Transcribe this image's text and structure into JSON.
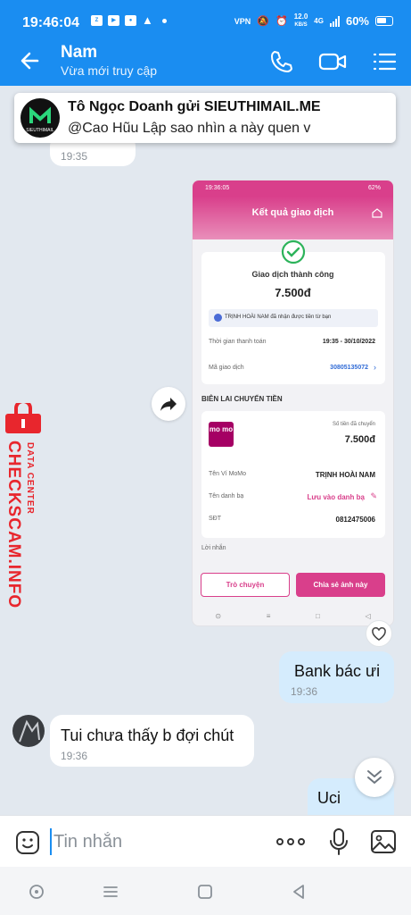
{
  "status_bar": {
    "time": "19:46:04",
    "speed_value": "12.0",
    "speed_unit": "KB/S",
    "battery": "60%",
    "left_icons": [
      "zalo-icon",
      "youtube-icon",
      "messenger-icon",
      "warning-icon",
      "dot-icon"
    ],
    "right_icons": [
      "vpn-icon",
      "mute-icon",
      "alarm-icon",
      "speed-icon",
      "4g-icon",
      "signal-icon",
      "battery-icon"
    ]
  },
  "header": {
    "name": "Nam",
    "subtitle": "Vừa mới truy cập",
    "icons": [
      "back-arrow-icon",
      "phone-icon",
      "video-call-icon",
      "menu-icon"
    ]
  },
  "pinned": {
    "title": "Tô Ngọc Doanh gửi SIEUTHIMAIL.ME",
    "text": "@Cao Hũu Lập sao nhìn a này quen v",
    "logo_text": "SIEUTHIMAIL"
  },
  "messages": {
    "m1_time": "19:35",
    "bank_text": "Bank bác ưi",
    "bank_time": "19:36",
    "reply_text": "Tui chưa thấy b đợi chút",
    "reply_time": "19:36",
    "last_text": "Uci"
  },
  "watermark": {
    "top_text": "DATA CENTER",
    "main_text": "CHECKSCAM.INFO",
    "color": "#e8262d"
  },
  "receipt": {
    "status_time": "19:36:05",
    "status_battery": "62%",
    "title": "Kết quả giao dịch",
    "success_text": "Giao dịch thành công",
    "amount": "7.500đ",
    "note": "TRỊNH HOÀI NAM đã nhận được tiền từ bạn",
    "time_label": "Thời gian thanh toán",
    "time_value": "19:35 - 30/10/2022",
    "code_label": "Mã giao dịch",
    "code_value": "30805135072",
    "section_title": "BIÊN LAI CHUYỂN TIỀN",
    "momo_text": "mo mo",
    "sent_label": "Số tiền đã chuyển",
    "sent_amount": "7.500đ",
    "wallet_label": "Tên Ví MoMo",
    "wallet_value": "TRỊNH HOÀI NAM",
    "contact_label": "Tên danh bạ",
    "contact_value": "Lưu vào danh bạ",
    "phone_label": "SĐT",
    "phone_value": "0812475006",
    "message_label": "Lời nhắn",
    "btn_chat": "Trò chuyện",
    "btn_share": "Chia sẻ ảnh này",
    "accent": "#d93f8b",
    "success_color": "#2cb35a"
  },
  "input": {
    "placeholder": "Tin nhắn",
    "icons": [
      "sticker-icon",
      "more-icon",
      "mic-icon",
      "image-icon"
    ]
  },
  "colors": {
    "brand": "#1a8df1",
    "chat_bg": "#e2e8ef",
    "my_bubble": "#d5ecfd"
  }
}
